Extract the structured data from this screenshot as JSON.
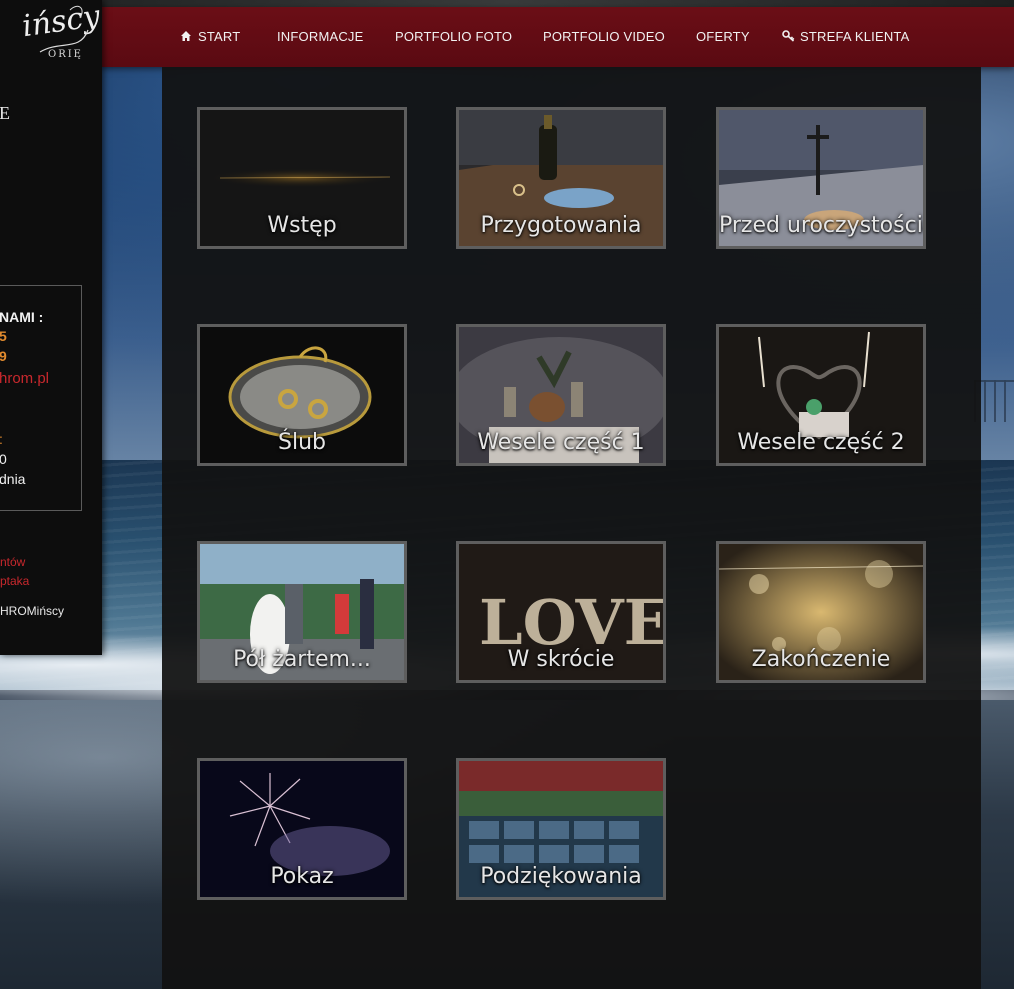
{
  "nav": {
    "items": [
      {
        "label": "START",
        "icon": "home-icon"
      },
      {
        "label": "INFORMACJE"
      },
      {
        "label": "PORTFOLIO FOTO"
      },
      {
        "label": "PORTFOLIO VIDEO"
      },
      {
        "label": "OFERTY"
      },
      {
        "label": "STREFA KLIENTA",
        "icon": "key-icon"
      }
    ]
  },
  "sidebar": {
    "logo_script": "ińscy",
    "logo_sub": "ORIĘ",
    "heading_letter": "E",
    "contact": {
      "heading": "NAMI :",
      "line1": "5",
      "line2": "9",
      "email_fragment": "hrom.pl",
      "line3": ":",
      "line4": "0",
      "line5": "dnia"
    },
    "links": [
      "ntów",
      "ptaka"
    ],
    "footer": "HROMińscy"
  },
  "gallery": {
    "items": [
      {
        "label": "Wstęp"
      },
      {
        "label": "Przygotowania"
      },
      {
        "label": "Przed uroczystością"
      },
      {
        "label": "Ślub"
      },
      {
        "label": "Wesele część 1"
      },
      {
        "label": "Wesele część 2"
      },
      {
        "label": "Pół żartem..."
      },
      {
        "label": "W skrócie"
      },
      {
        "label": "Zakończenie"
      },
      {
        "label": "Pokaz"
      },
      {
        "label": "Podziękowania"
      }
    ]
  },
  "colors": {
    "navbar": "#5a0a12",
    "accent_red": "#c8282d",
    "accent_orange": "#e08a2e",
    "tile_border": "#5e5e5e"
  }
}
